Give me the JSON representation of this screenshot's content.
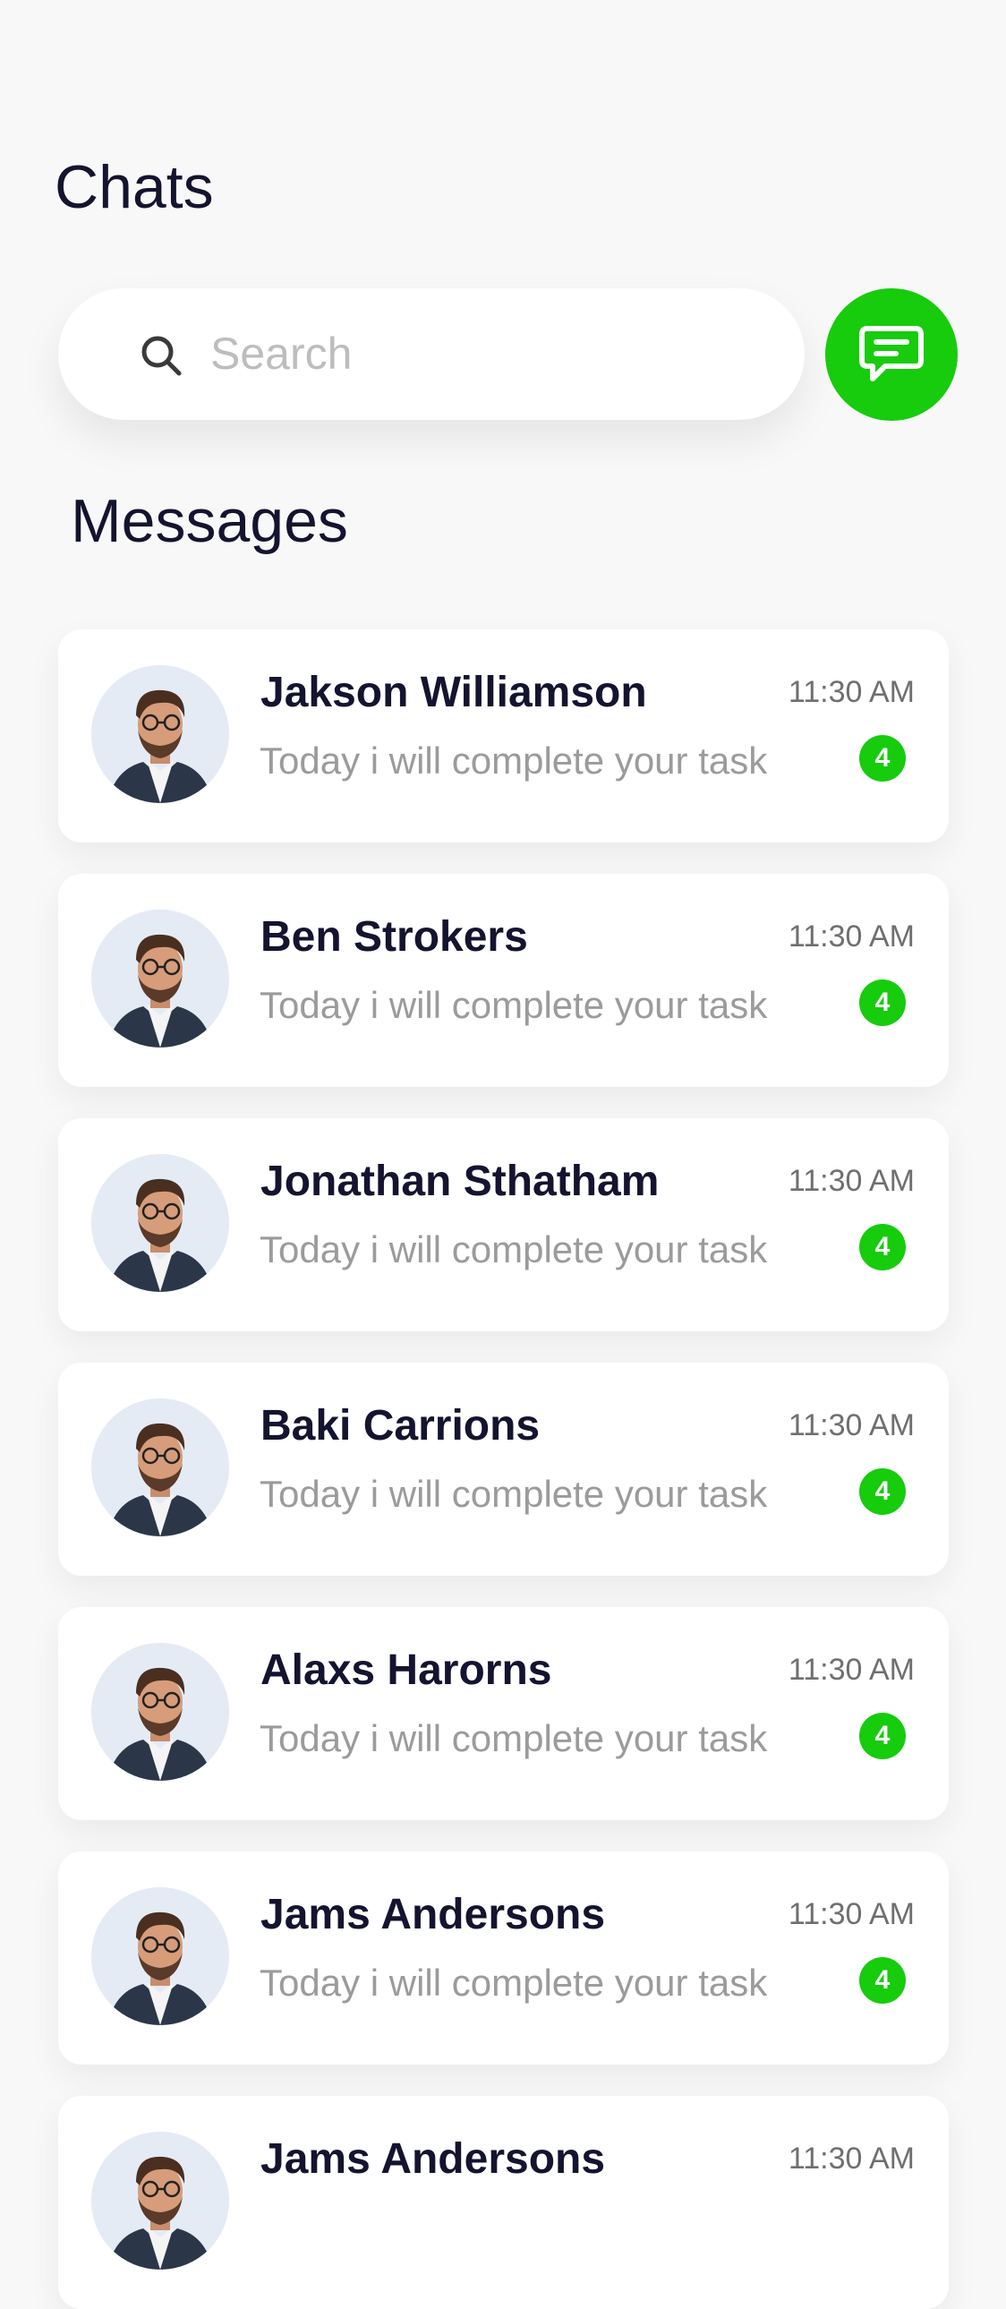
{
  "header": {
    "title": "Chats"
  },
  "search": {
    "placeholder": "Search",
    "value": ""
  },
  "compose": {
    "icon": "chat-compose-icon",
    "color": "#16cc0c"
  },
  "messages_section": {
    "title": "Messages"
  },
  "chats": [
    {
      "name": "Jakson Williamson",
      "preview": "Today i will complete your task",
      "time": "11:30 AM",
      "unread": "4"
    },
    {
      "name": "Ben Strokers",
      "preview": "Today i will complete your task",
      "time": "11:30 AM",
      "unread": "4"
    },
    {
      "name": "Jonathan Sthatham",
      "preview": "Today i will complete your task",
      "time": "11:30 AM",
      "unread": "4"
    },
    {
      "name": "Baki Carrions",
      "preview": "Today i will complete your task",
      "time": "11:30 AM",
      "unread": "4"
    },
    {
      "name": "Alaxs Harorns",
      "preview": "Today i will complete your task",
      "time": "11:30 AM",
      "unread": "4"
    },
    {
      "name": "Jams Andersons",
      "preview": "Today i will complete your task",
      "time": "11:30 AM",
      "unread": "4"
    },
    {
      "name": "Jams Andersons",
      "preview": "",
      "time": "11:30 AM",
      "unread": ""
    }
  ]
}
